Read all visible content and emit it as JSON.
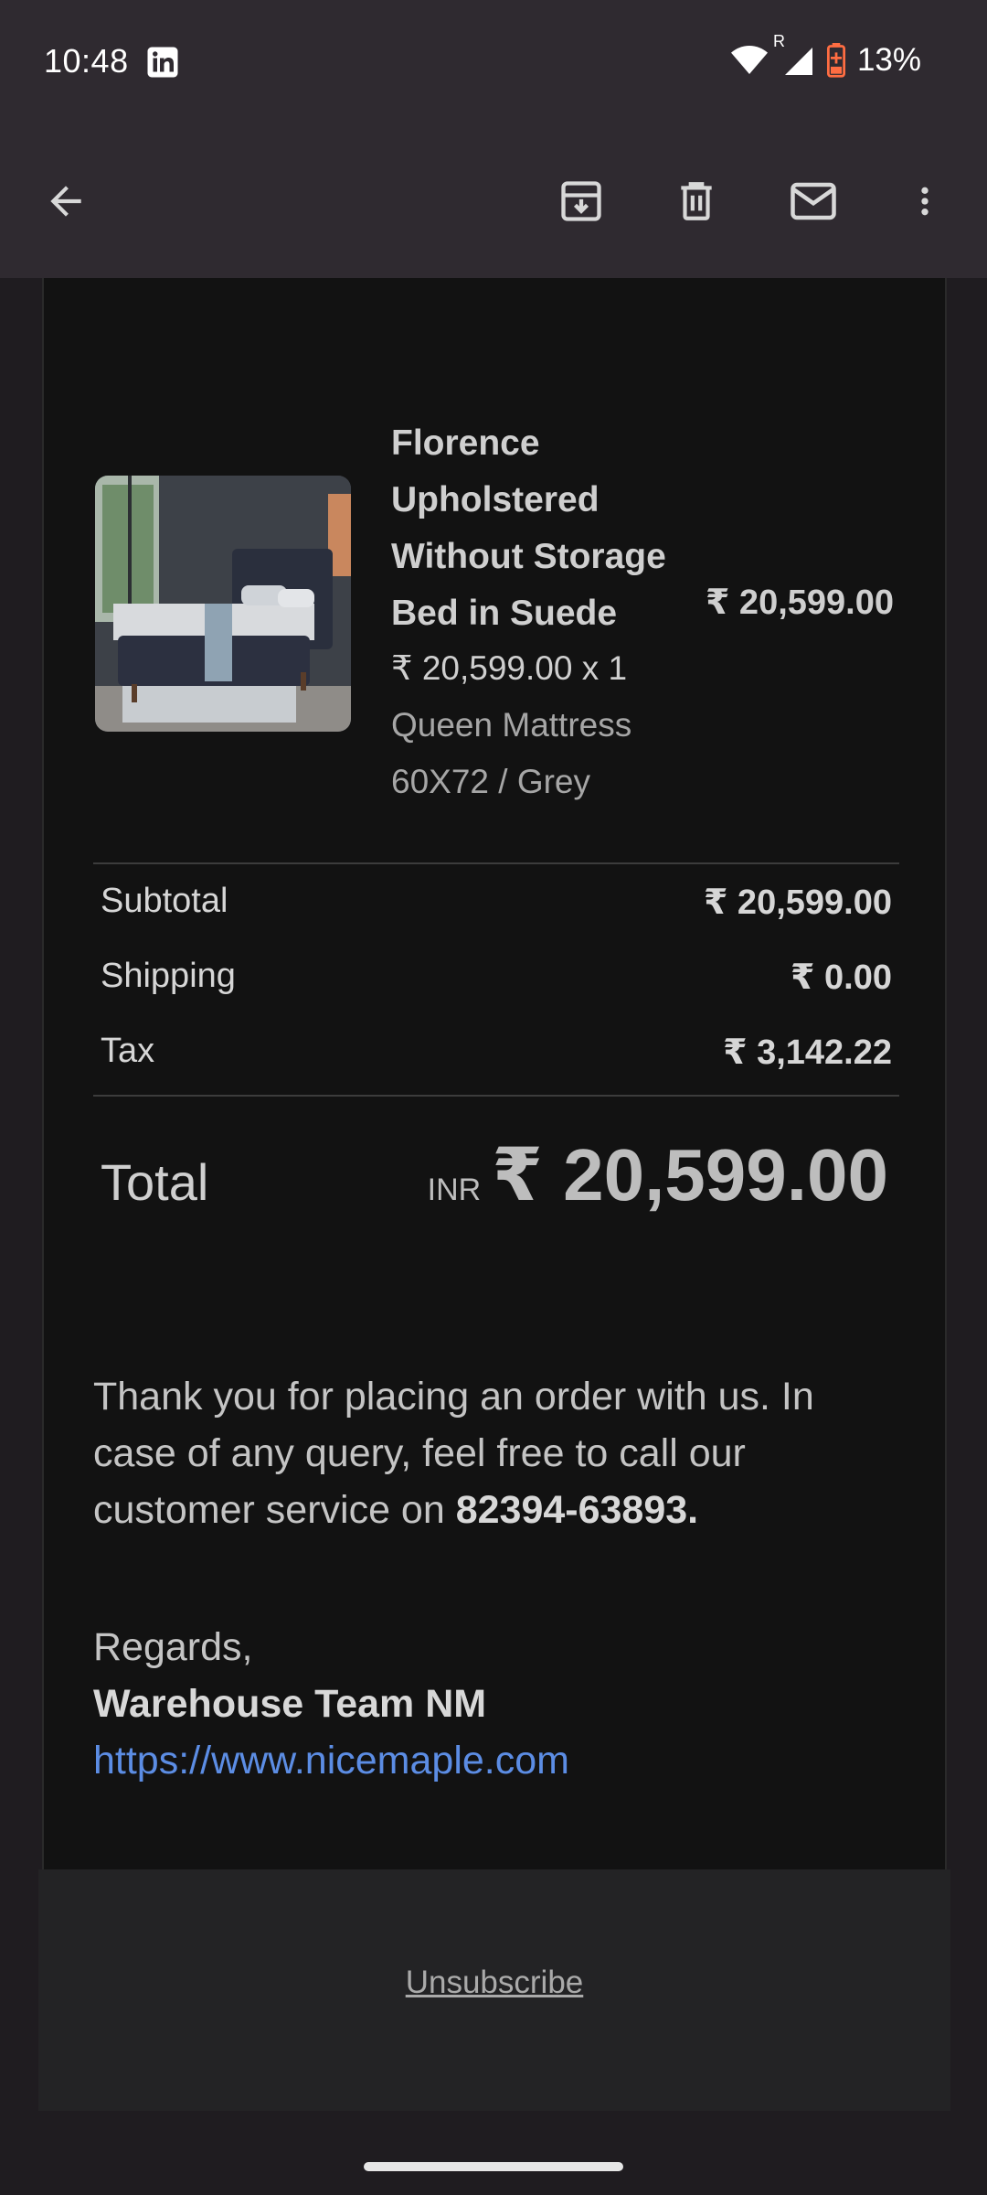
{
  "status_bar": {
    "time": "10:48",
    "battery": "13%",
    "app_icon": "linkedin-icon",
    "roaming_indicator": "R"
  },
  "app_bar": {
    "icons": [
      "back-arrow-icon",
      "archive-icon",
      "delete-icon",
      "mark-unread-icon",
      "more-vert-icon"
    ]
  },
  "product": {
    "name": "Florence Upholstered Without Storage Bed in Suede",
    "price": "₹ 20,599.00",
    "qty_line": "₹ 20,599.00 x 1",
    "variant": "Queen Mattress 60X72 / Grey"
  },
  "summary": {
    "subtotal_label": "Subtotal",
    "subtotal_value": "₹ 20,599.00",
    "shipping_label": "Shipping",
    "shipping_value": "₹ 0.00",
    "tax_label": "Tax",
    "tax_value": "₹ 3,142.22",
    "total_label": "Total",
    "total_currency": "INR",
    "total_value": "₹ 20,599.00"
  },
  "message": {
    "thanks": "Thank you for placing an order with us. In case of any query, feel free to call our customer service on ",
    "phone": "82394-63893.",
    "regards": "Regards,",
    "team": "Warehouse Team NM",
    "link": "https://www.nicemaple.com"
  },
  "footer": {
    "unsubscribe": "Unsubscribe"
  },
  "colors": {
    "app_bar": "#2f2a30",
    "email_bg": "#121212",
    "link": "#5c8de4"
  }
}
